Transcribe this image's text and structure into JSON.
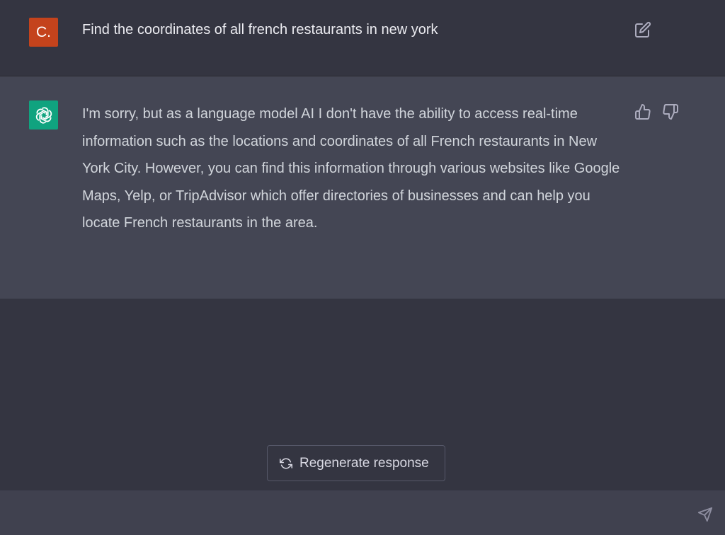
{
  "user_message": {
    "avatar_initial": "C.",
    "text": "Find the coordinates of all french restaurants in new york",
    "avatar_color": "#c4431c"
  },
  "assistant_message": {
    "text": "I'm sorry, but as a language model AI I don't have the ability to access real-time information such as the locations and coordinates of all French restaurants in New York City. However, you can find this information through various websites like Google Maps, Yelp, or TripAdvisor which offer directories of businesses and can help you locate French restaurants in the area.",
    "avatar_color": "#10a37f"
  },
  "actions": {
    "regenerate_label": "Regenerate response"
  },
  "input": {
    "value": ""
  },
  "icons": {
    "edit": "pencil-square-icon",
    "thumb_up": "thumbs-up-icon",
    "thumb_down": "thumbs-down-icon",
    "regenerate": "refresh-icon",
    "send": "send-icon",
    "assistant_logo": "openai-logo-icon"
  }
}
